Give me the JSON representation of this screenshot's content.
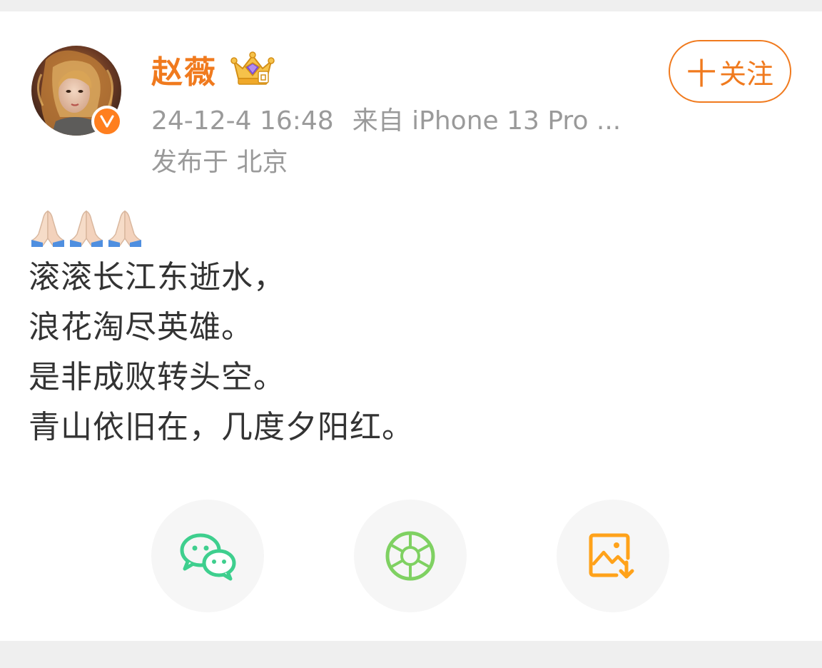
{
  "post": {
    "author": {
      "name": "赵薇",
      "verified_icon": "verified-v-badge",
      "vip_icon": "crown-badge-icon",
      "avatar": "avatar-image"
    },
    "timestamp": "24-12-4 16:48",
    "source": "来自 iPhone 13 Pro ...",
    "location": "发布于 北京",
    "follow_label": "关注",
    "follow_plus": "十",
    "emoji": [
      "🙏🏻",
      "🙏🏻",
      "🙏🏻"
    ],
    "lines": [
      "滚滚长江东逝水，",
      "浪花淘尽英雄。",
      "是非成败转头空。",
      "青山依旧在，几度夕阳红。"
    ]
  },
  "share": {
    "buttons": [
      {
        "icon": "wechat-icon",
        "color": "#3ecf8e"
      },
      {
        "icon": "moments-icon",
        "color": "#7fd162"
      },
      {
        "icon": "save-image-icon",
        "color": "#ffa21a"
      }
    ]
  },
  "colors": {
    "accent": "#f07a1e",
    "text": "#333333",
    "meta": "#9a9a9a",
    "background": "#efefef"
  }
}
